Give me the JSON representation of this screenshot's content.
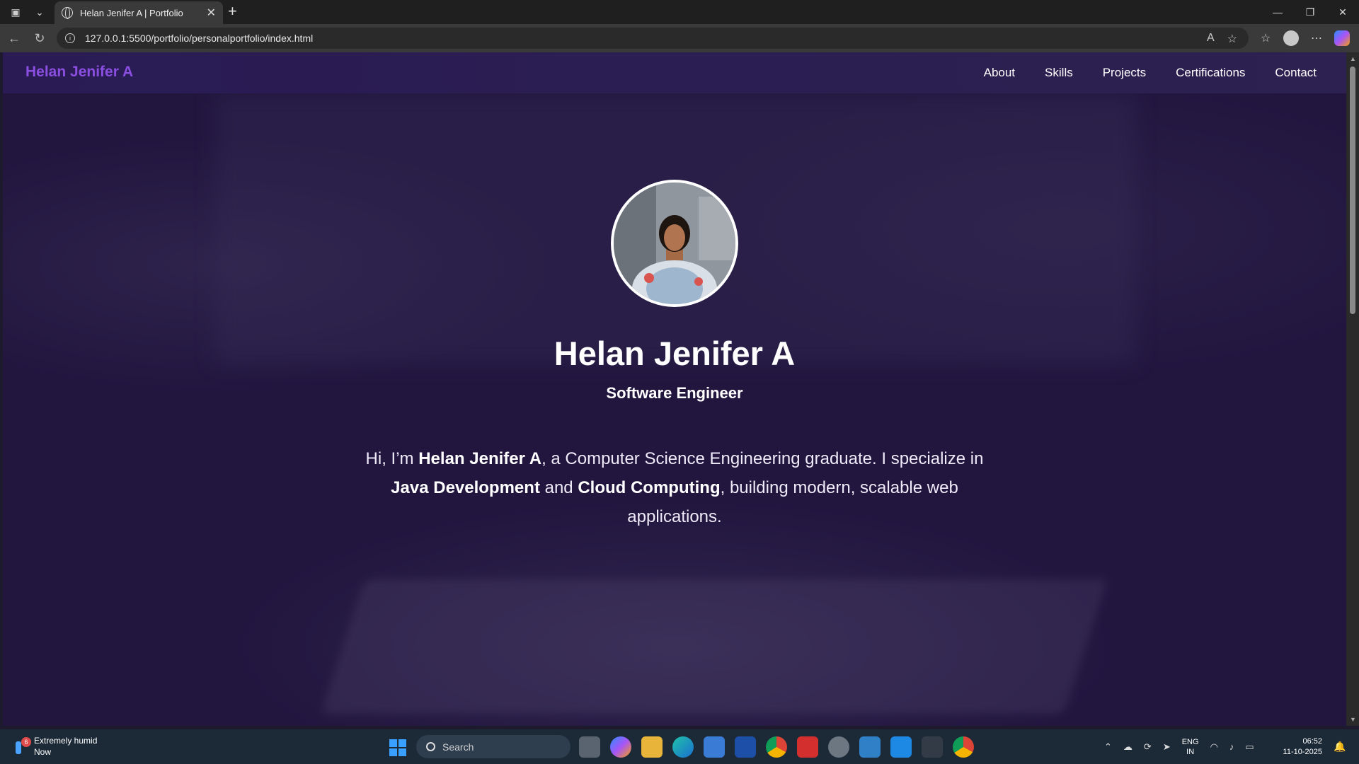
{
  "browser": {
    "tab_title": "Helan Jenifer A | Portfolio",
    "url": "127.0.0.1:5500/portfolio/personalportfolio/index.html",
    "tab_close": "✕",
    "new_tab": "+"
  },
  "site": {
    "brand": "Helan Jenifer A",
    "nav": [
      "About",
      "Skills",
      "Projects",
      "Certifications",
      "Contact"
    ],
    "colors": {
      "brand": "#8a4fe0",
      "navbar": "#2a1b54",
      "background": "#22163f"
    }
  },
  "hero": {
    "name": "Helan Jenifer A",
    "role": "Software Engineer",
    "intro": {
      "p1": "Hi, I’m ",
      "b1": "Helan Jenifer A",
      "p2": ", a Computer Science Engineering graduate. I specialize in ",
      "b2": "Java Development",
      "p3": " and ",
      "b3": "Cloud Computing",
      "p4": ", building modern, scalable web applications."
    }
  },
  "taskbar": {
    "weather_title": "Extremely humid",
    "weather_sub": "Now",
    "weather_badge": "6",
    "search_placeholder": "Search",
    "lang_line1": "ENG",
    "lang_line2": "IN",
    "time": "06:52",
    "date": "11-10-2025"
  }
}
